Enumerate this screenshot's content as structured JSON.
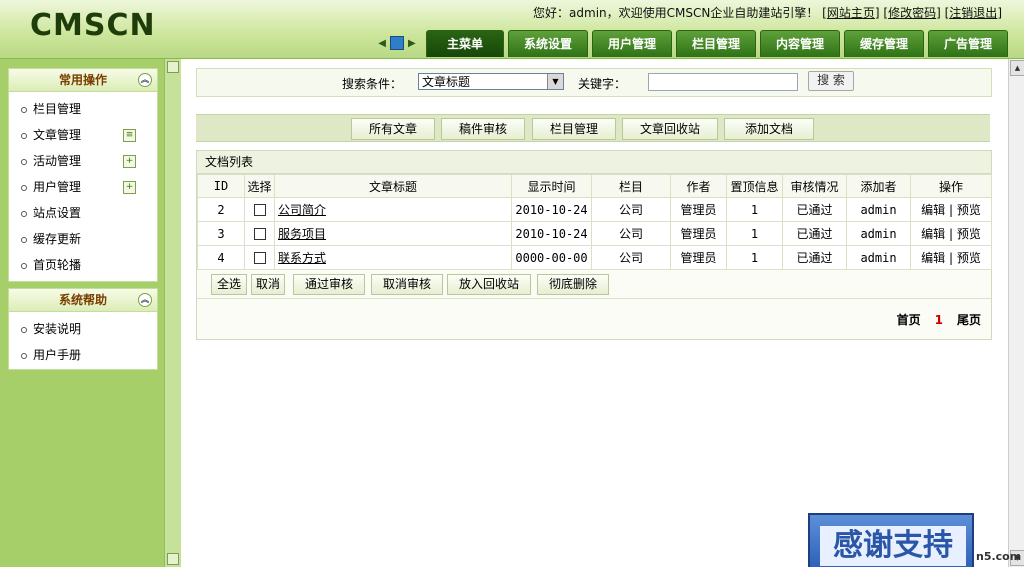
{
  "header": {
    "logo": "CMSCN",
    "welcome_prefix": "您好：admin，欢迎使用CMSCN企业自助建站引擎！",
    "links": [
      "[",
      "网站主页",
      "]",
      "[",
      "修改密码",
      "]",
      "[",
      "注销退出",
      "]"
    ],
    "tabs": [
      "主菜单",
      "系统设置",
      "用户管理",
      "栏目管理",
      "内容管理",
      "缓存管理",
      "广告管理"
    ]
  },
  "sidebar": {
    "panel1": {
      "title": "常用操作",
      "items": [
        "栏目管理",
        "文章管理",
        "活动管理",
        "用户管理",
        "站点设置",
        "缓存更新",
        "首页轮播"
      ]
    },
    "panel2": {
      "title": "系统帮助",
      "items": [
        "安装说明",
        "用户手册"
      ]
    }
  },
  "search": {
    "label": "搜索条件：",
    "selected": "文章标题",
    "keyword_label": "关键字：",
    "keyword_value": "",
    "button": "搜 索"
  },
  "actions": [
    "所有文章",
    "稿件审核",
    "栏目管理",
    "文章回收站",
    "添加文档"
  ],
  "list": {
    "title": "文档列表",
    "columns": [
      "ID",
      "选择",
      "文章标题",
      "显示时间",
      "栏目",
      "作者",
      "置顶信息",
      "审核情况",
      "添加者",
      "操作"
    ],
    "rows": [
      {
        "id": "2",
        "title": "公司简介",
        "date": "2010-10-24",
        "column": "公司",
        "author": "管理员",
        "top": "1",
        "status": "已通过",
        "adder": "admin",
        "edit": "编辑",
        "sep": "|",
        "preview": "预览"
      },
      {
        "id": "3",
        "title": "服务项目",
        "date": "2010-10-24",
        "column": "公司",
        "author": "管理员",
        "top": "1",
        "status": "已通过",
        "adder": "admin",
        "edit": "编辑",
        "sep": "|",
        "preview": "预览"
      },
      {
        "id": "4",
        "title": "联系方式",
        "date": "0000-00-00",
        "column": "公司",
        "author": "管理员",
        "top": "1",
        "status": "已通过",
        "adder": "admin",
        "edit": "编辑",
        "sep": "|",
        "preview": "预览"
      }
    ],
    "bulk": [
      "全选",
      "取消",
      "通过审核",
      "取消审核",
      "放入回收站",
      "彻底删除"
    ],
    "pager": {
      "first": "首页",
      "current": "1",
      "last": "尾页"
    }
  },
  "banner": {
    "text": "感谢支持",
    "corner": "n5.com"
  }
}
